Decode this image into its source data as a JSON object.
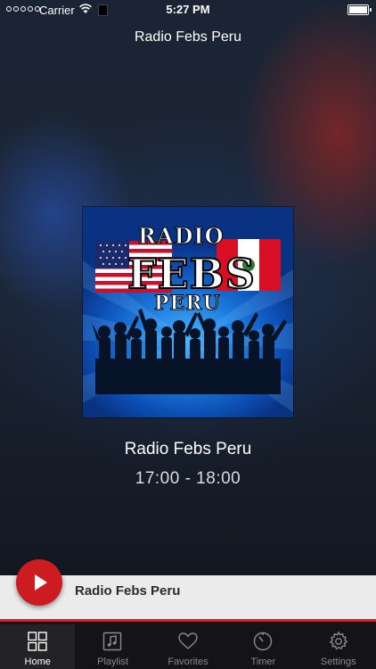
{
  "status_bar": {
    "carrier": "Carrier",
    "time": "5:27 PM"
  },
  "nav": {
    "title": "Radio Febs Peru"
  },
  "artwork": {
    "line1": "RADIO",
    "line2": "FEBS",
    "line3": "PERU"
  },
  "now_playing": {
    "station": "Radio Febs Peru",
    "schedule": "17:00 - 18:00"
  },
  "mini_player": {
    "title": "Radio Febs Peru"
  },
  "tabs": [
    {
      "label": "Home",
      "icon": "grid-icon",
      "active": true
    },
    {
      "label": "Playlist",
      "icon": "music-note-icon",
      "active": false
    },
    {
      "label": "Favorites",
      "icon": "heart-icon",
      "active": false
    },
    {
      "label": "Timer",
      "icon": "timer-icon",
      "active": false
    },
    {
      "label": "Settings",
      "icon": "gear-icon",
      "active": false
    }
  ],
  "colors": {
    "accent": "#cc1c22",
    "tab_bar": "#141416",
    "mini_player": "#ebebeb"
  }
}
